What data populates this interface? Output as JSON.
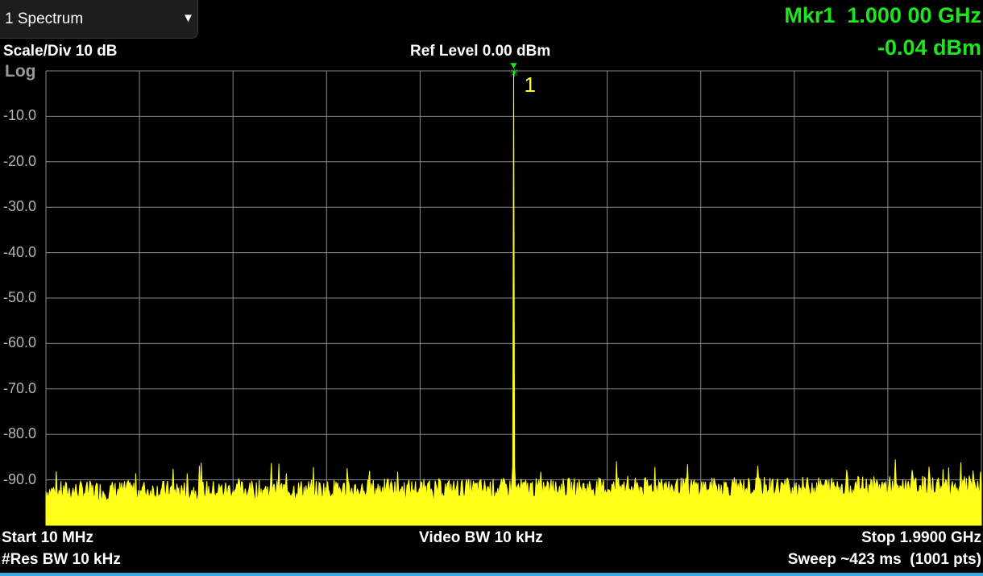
{
  "window": {
    "selector_label": "1 Spectrum",
    "selector_icon": "dropdown-triangle-icon"
  },
  "marker_readout": {
    "frequency": "Mkr1  1.000 00 GHz",
    "amplitude": "-0.04 dBm",
    "color": "#1ee61e"
  },
  "header": {
    "scale": "Scale/Div 10 dB",
    "ref_level": "Ref Level 0.00 dBm",
    "scale_type": "Log"
  },
  "footer": {
    "start": "Start 10 MHz",
    "video_bw": "Video BW 10 kHz",
    "stop": "Stop 1.9900 GHz",
    "res_bw": "#Res BW 10 kHz",
    "sweep": "Sweep ~423 ms  (1001 pts)"
  },
  "colors": {
    "trace": "#ffff1a",
    "marker": "#1ee61e",
    "grid": "#8a8a8a",
    "background": "#000000"
  },
  "chart_data": {
    "type": "line",
    "y_tick_labels": [
      "-10.0",
      "-20.0",
      "-30.0",
      "-40.0",
      "-50.0",
      "-60.0",
      "-70.0",
      "-80.0",
      "-90.0"
    ],
    "ylim": [
      -100,
      0
    ],
    "xlim_ghz": [
      0.01,
      1.99
    ],
    "grid": true,
    "series": [
      {
        "peak": {
          "x_ghz": 1.0,
          "y_dbm": -0.04
        },
        "noise_floor_dbm": -92.5,
        "points": 1001
      }
    ],
    "marker": {
      "label": "1",
      "x_ghz": 1.0,
      "y_dbm": -0.04
    }
  }
}
